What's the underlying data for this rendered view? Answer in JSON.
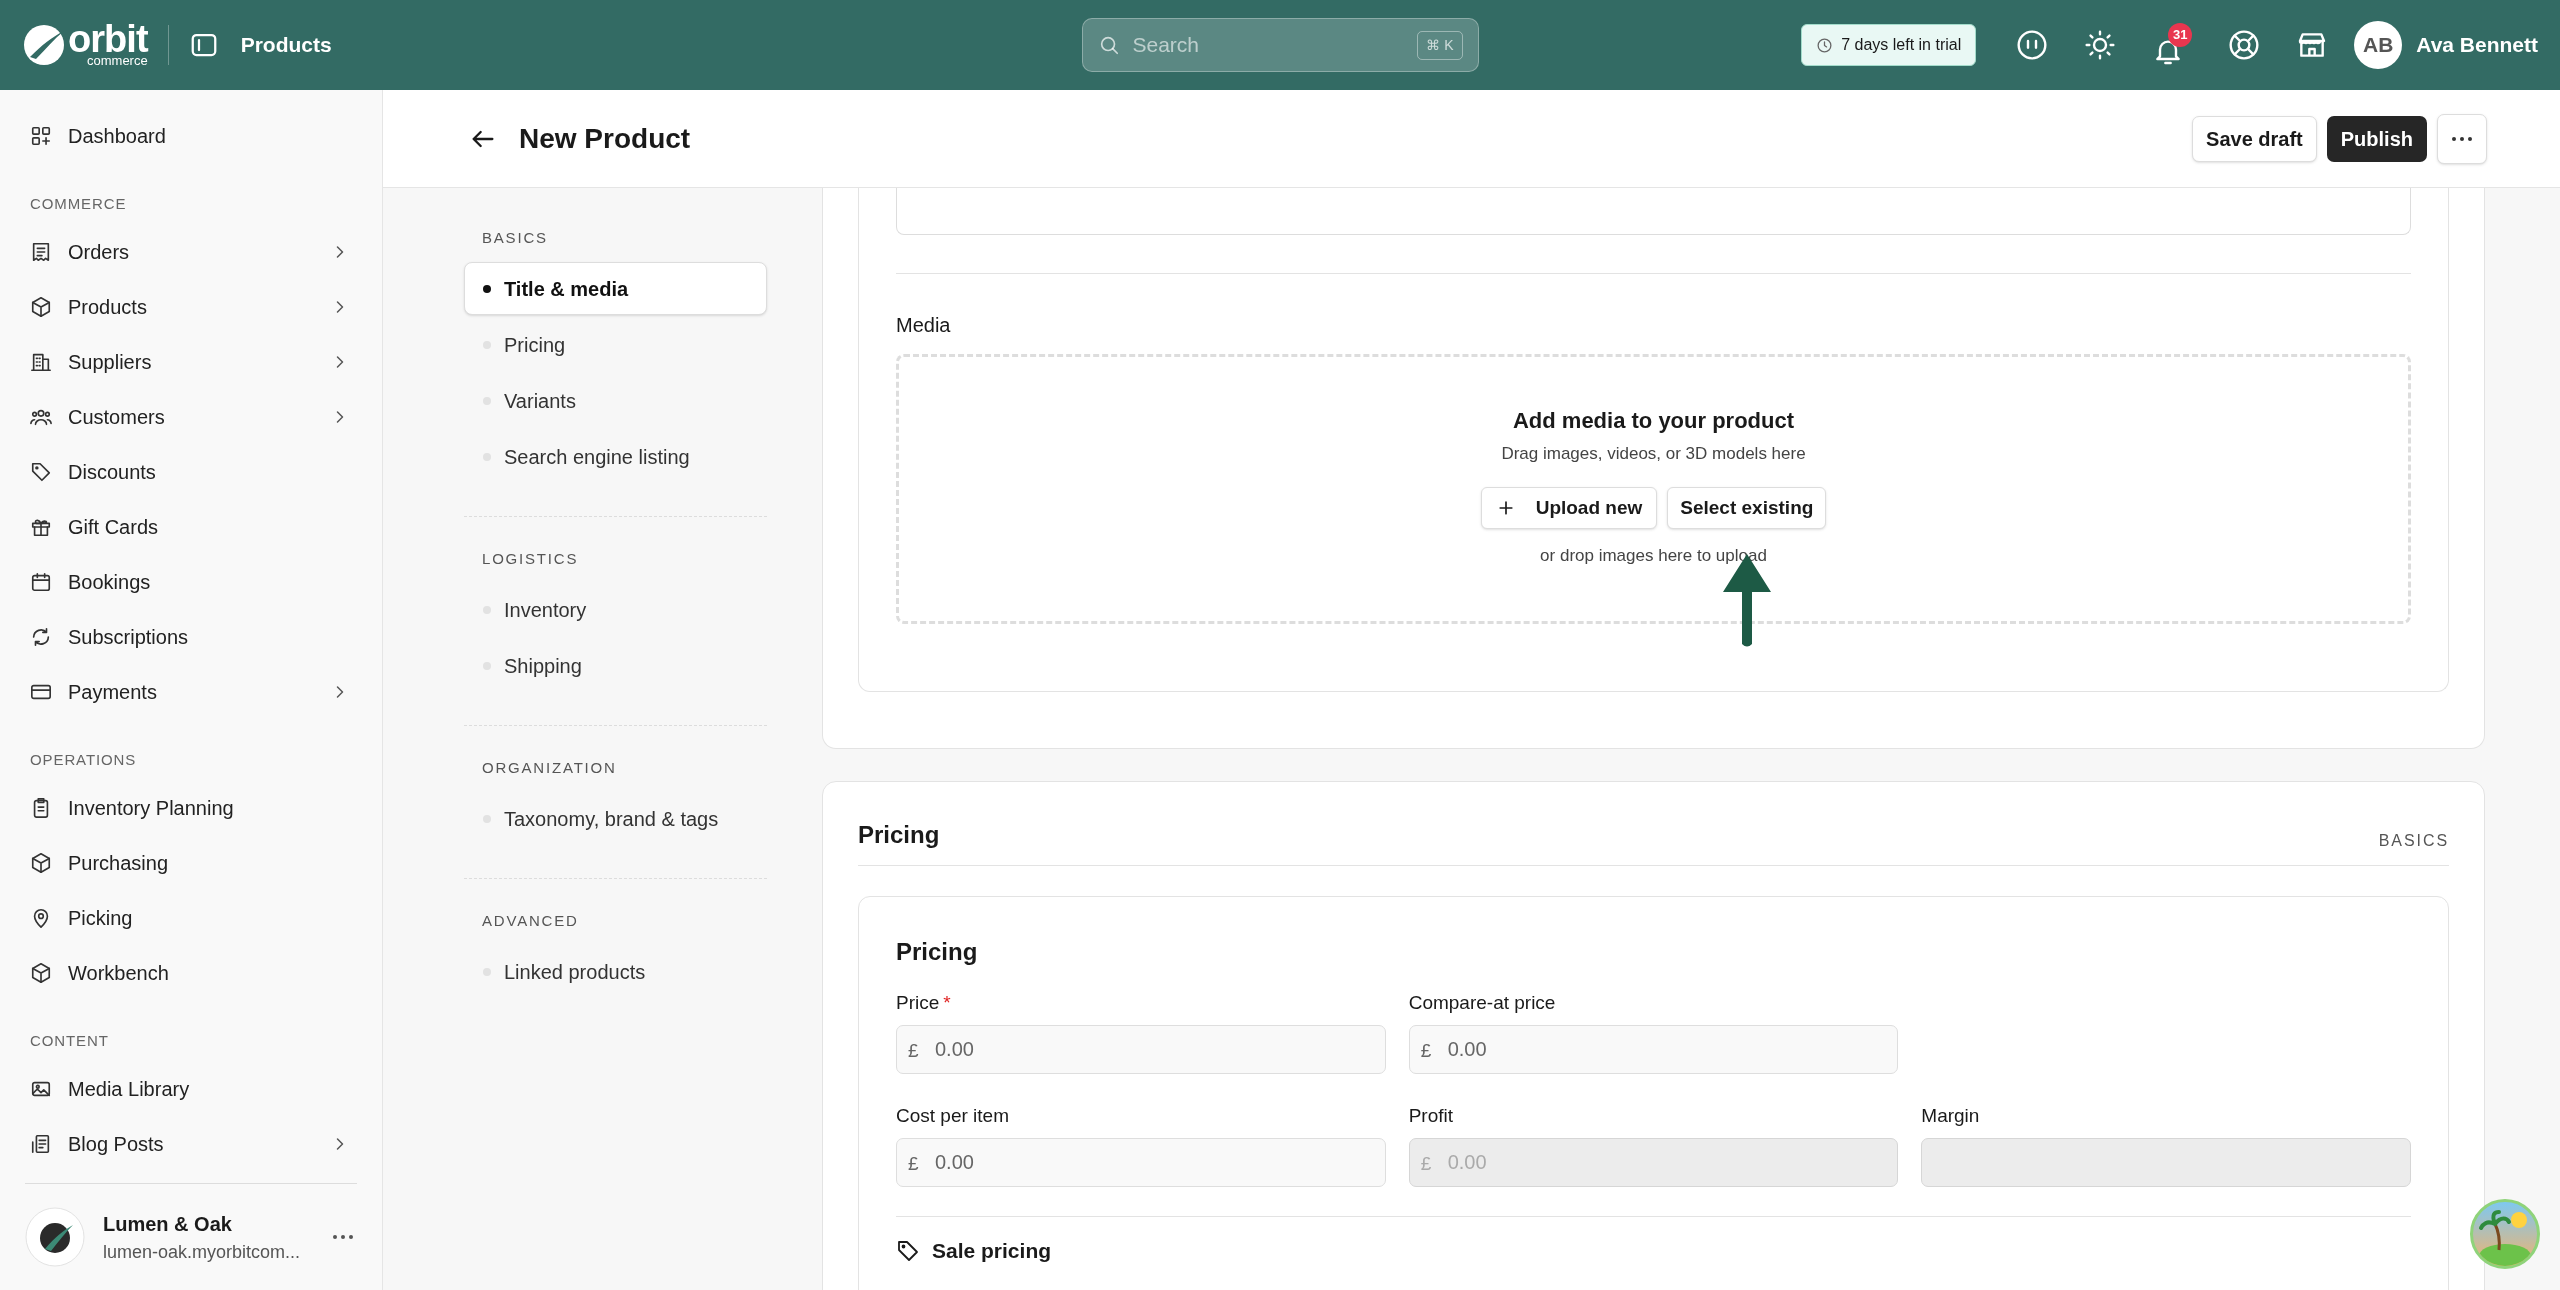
{
  "topbar": {
    "brand": "orbit",
    "brand_sub": "commerce",
    "section": "Products",
    "search": {
      "placeholder": "Search",
      "shortcut": "⌘ K"
    },
    "trial": "7 days left in trial",
    "notifications": "31",
    "user": {
      "initials": "AB",
      "name": "Ava Bennett"
    }
  },
  "sidebar": {
    "sections": [
      {
        "items": [
          {
            "label": "Dashboard",
            "expandable": false
          }
        ]
      },
      {
        "heading": "COMMERCE",
        "items": [
          {
            "label": "Orders",
            "expandable": true
          },
          {
            "label": "Products",
            "expandable": true
          },
          {
            "label": "Suppliers",
            "expandable": true
          },
          {
            "label": "Customers",
            "expandable": true
          },
          {
            "label": "Discounts",
            "expandable": false
          },
          {
            "label": "Gift Cards",
            "expandable": false
          },
          {
            "label": "Bookings",
            "expandable": false
          },
          {
            "label": "Subscriptions",
            "expandable": false
          },
          {
            "label": "Payments",
            "expandable": true
          }
        ]
      },
      {
        "heading": "OPERATIONS",
        "items": [
          {
            "label": "Inventory Planning",
            "expandable": false
          },
          {
            "label": "Purchasing",
            "expandable": false
          },
          {
            "label": "Picking",
            "expandable": false
          },
          {
            "label": "Workbench",
            "expandable": false
          }
        ]
      },
      {
        "heading": "CONTENT",
        "items": [
          {
            "label": "Media Library",
            "expandable": false
          },
          {
            "label": "Blog Posts",
            "expandable": true
          }
        ]
      }
    ],
    "account": {
      "name": "Lumen & Oak",
      "domain": "lumen-oak.myorbitcom..."
    }
  },
  "page_header": {
    "title": "New Product",
    "actions": [
      {
        "kind": "secondary",
        "label": "Save draft"
      },
      {
        "kind": "primary",
        "label": "Publish"
      },
      {
        "kind": "more"
      }
    ]
  },
  "section_nav": [
    {
      "heading": "BASICS",
      "items": [
        {
          "label": "Title & media",
          "selected": true
        },
        {
          "label": "Pricing",
          "selected": false
        },
        {
          "label": "Variants",
          "selected": false
        },
        {
          "label": "Search engine listing",
          "selected": false
        }
      ]
    },
    {
      "heading": "LOGISTICS",
      "items": [
        {
          "label": "Inventory",
          "selected": false
        },
        {
          "label": "Shipping",
          "selected": false
        }
      ]
    },
    {
      "heading": "ORGANIZATION",
      "items": [
        {
          "label": "Taxonomy, brand & tags",
          "selected": false
        }
      ]
    },
    {
      "heading": "ADVANCED",
      "items": [
        {
          "label": "Linked products",
          "selected": false
        }
      ]
    }
  ],
  "media": {
    "label": "Media",
    "title": "Add media to your product",
    "hint": "Drag images, videos, or 3D models here",
    "buttons": [
      {
        "kind": "upload",
        "label": "Upload new"
      },
      {
        "kind": "plain",
        "label": "Select existing"
      }
    ],
    "note": "or drop images here to upload"
  },
  "pricing_section": {
    "title": "Pricing",
    "tag": "BASICS",
    "card_title": "Pricing",
    "rows": [
      [
        {
          "label": "Price",
          "required_mark": "*",
          "prefix": "£",
          "placeholder": "0.00",
          "disabled": false
        },
        {
          "label": "Compare-at price",
          "prefix": "£",
          "placeholder": "0.00",
          "disabled": false
        }
      ],
      [
        {
          "label": "Cost per item",
          "prefix": "£",
          "placeholder": "0.00",
          "disabled": false
        },
        {
          "label": "Profit",
          "prefix": "£",
          "placeholder": "0.00",
          "disabled": true
        },
        {
          "label": "Margin",
          "disabled": true
        }
      ]
    ],
    "sale_pricing": "Sale pricing"
  }
}
